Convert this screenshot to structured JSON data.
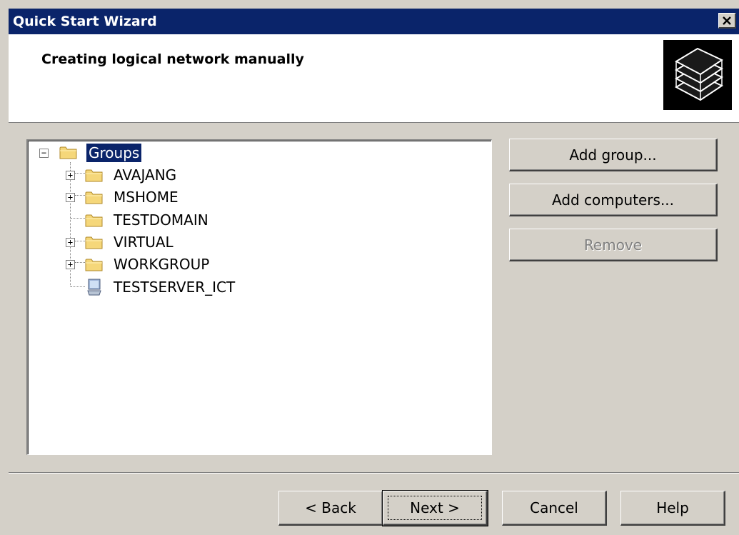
{
  "window": {
    "title": "Quick Start Wizard",
    "close_icon": "close-icon"
  },
  "header": {
    "heading": "Creating logical network manually",
    "logo_icon": "server-stack-icon"
  },
  "tree": {
    "root": {
      "label": "Groups",
      "expander": "⊟",
      "icon": "folder-icon",
      "selected": true
    },
    "items": [
      {
        "label": "AVAJANG",
        "expandable": true,
        "icon": "folder-icon"
      },
      {
        "label": "MSHOME",
        "expandable": true,
        "icon": "folder-icon"
      },
      {
        "label": "TESTDOMAIN",
        "expandable": false,
        "icon": "folder-icon"
      },
      {
        "label": "VIRTUAL",
        "expandable": true,
        "icon": "folder-icon"
      },
      {
        "label": "WORKGROUP",
        "expandable": true,
        "icon": "folder-icon"
      },
      {
        "label": "TESTSERVER_ICT",
        "expandable": false,
        "icon": "computer-icon"
      }
    ]
  },
  "side_buttons": {
    "add_group": "Add group...",
    "add_computers": "Add computers...",
    "remove": "Remove",
    "remove_disabled": true
  },
  "footer": {
    "back": "< Back",
    "next": "Next >",
    "cancel": "Cancel",
    "help": "Help"
  },
  "colors": {
    "titlebar": "#0a246a",
    "dialog_bg": "#d4d0c8",
    "selection": "#0a246a"
  }
}
